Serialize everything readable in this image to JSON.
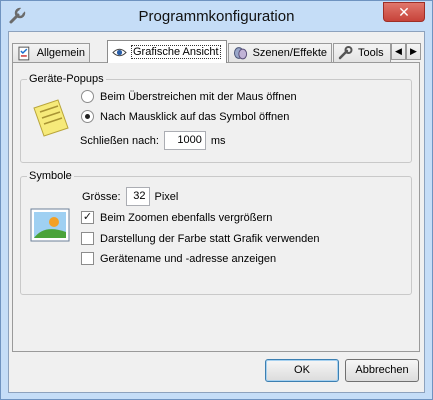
{
  "window": {
    "title": "Programmkonfiguration",
    "close_glyph": "✕"
  },
  "tabs": [
    {
      "label": "Allgemein",
      "icon": "checklist-icon"
    },
    {
      "label": "Grafische Ansicht",
      "icon": "eye-icon",
      "active": true
    },
    {
      "label": "Szenen/Effekte",
      "icon": "masks-icon"
    },
    {
      "label": "Tools",
      "icon": "tools-icon"
    }
  ],
  "tab_scroll": {
    "left": "◀",
    "right": "▶"
  },
  "popups": {
    "title": "Geräte-Popups",
    "option_hover": "Beim Überstreichen mit der Maus öffnen",
    "option_click": "Nach Mausklick auf das Symbol öffnen",
    "close_label": "Schließen nach:",
    "close_value": "1000",
    "close_unit": "ms"
  },
  "symbols": {
    "title": "Symbole",
    "size_label": "Grösse:",
    "size_value": "32",
    "size_unit": "Pixel",
    "check_zoom": "Beim Zoomen ebenfalls vergrößern",
    "check_color": "Darstellung der Farbe statt Grafik verwenden",
    "check_name": "Gerätename und -adresse anzeigen",
    "check_mark": "✓"
  },
  "buttons": {
    "ok": "OK",
    "cancel": "Abbrechen"
  },
  "colors": {
    "titlebar": "#c5ddf7",
    "close": "#c7433a",
    "face": "#f0f0f0"
  }
}
